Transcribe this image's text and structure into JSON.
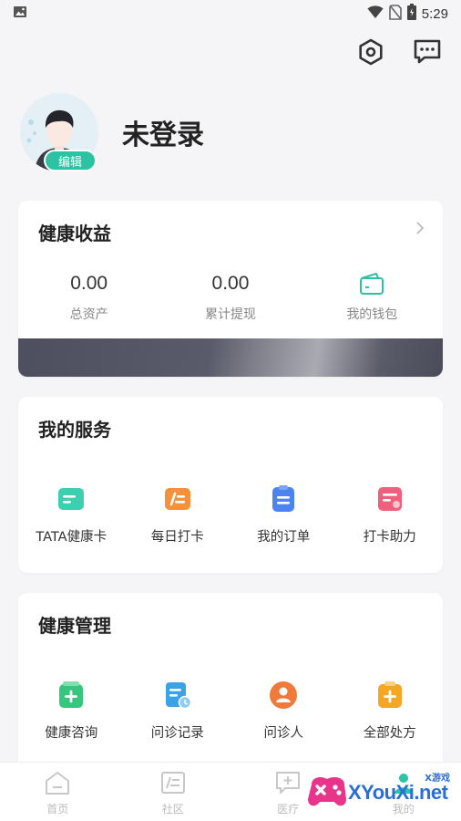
{
  "status_bar": {
    "time": "5:29"
  },
  "profile": {
    "name": "未登录",
    "edit_label": "编辑"
  },
  "earnings": {
    "title": "健康收益",
    "stats": [
      {
        "value": "0.00",
        "label": "总资产"
      },
      {
        "value": "0.00",
        "label": "累计提现"
      }
    ],
    "wallet_label": "我的钱包"
  },
  "services": {
    "title": "我的服务",
    "items": [
      {
        "label": "TATA健康卡",
        "icon": "health-card-icon",
        "color": "#3ccfb0"
      },
      {
        "label": "每日打卡",
        "icon": "daily-checkin-icon",
        "color": "#f5913a"
      },
      {
        "label": "我的订单",
        "icon": "order-icon",
        "color": "#4c83f0"
      },
      {
        "label": "打卡助力",
        "icon": "boost-icon",
        "color": "#f0607c"
      }
    ]
  },
  "management": {
    "title": "健康管理",
    "items": [
      {
        "label": "健康咨询",
        "icon": "consult-icon",
        "color": "#35c77d"
      },
      {
        "label": "问诊记录",
        "icon": "record-icon",
        "color": "#3aa3e8"
      },
      {
        "label": "问诊人",
        "icon": "patient-icon",
        "color": "#f07a3a"
      },
      {
        "label": "全部处方",
        "icon": "prescription-icon",
        "color": "#f5a623"
      }
    ]
  },
  "tabbar": {
    "tabs": [
      {
        "label": "首页",
        "icon": "home-icon"
      },
      {
        "label": "社区",
        "icon": "community-icon"
      },
      {
        "label": "医疗",
        "icon": "medical-icon"
      },
      {
        "label": "我的",
        "icon": "profile-icon"
      }
    ]
  },
  "watermark": {
    "text": "XYouXi.net",
    "small": "X游戏"
  },
  "colors": {
    "accent": "#2cc3a5",
    "background": "#f5f5f7"
  }
}
